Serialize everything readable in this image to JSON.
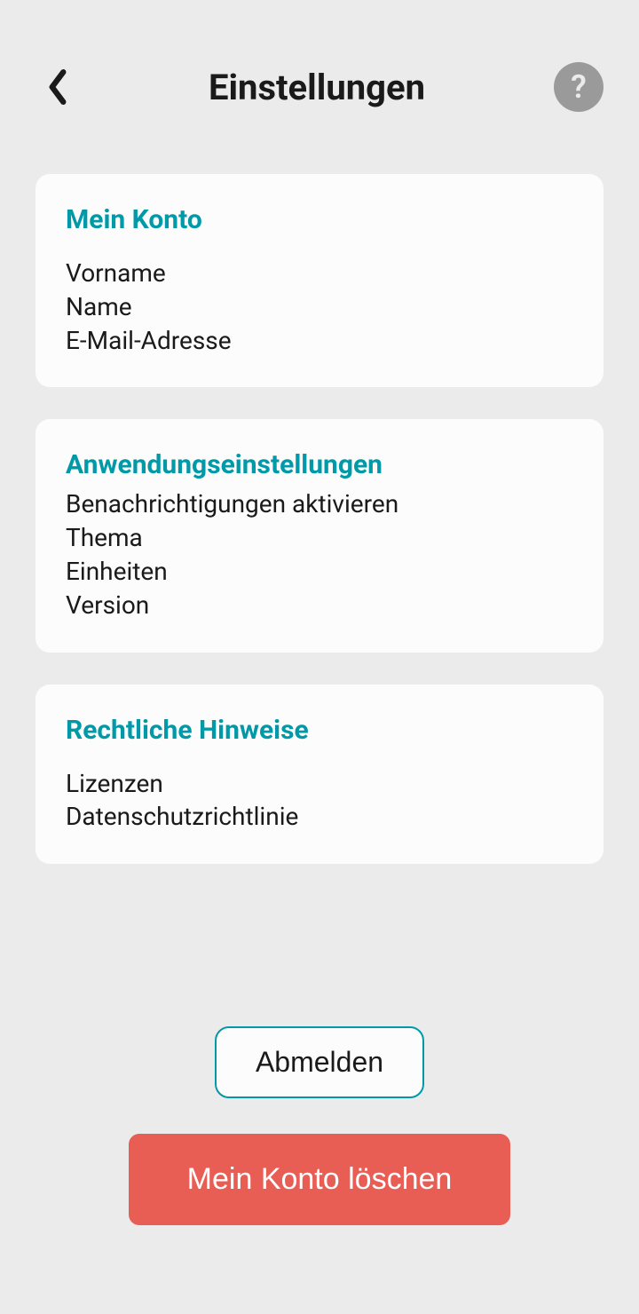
{
  "header": {
    "title": "Einstellungen",
    "help_label": "?"
  },
  "sections": {
    "account": {
      "title": "Mein Konto",
      "items": {
        "firstname": "Vorname",
        "lastname": "Name",
        "email": "E-Mail-Adresse"
      }
    },
    "app_settings": {
      "title": "Anwendungseinstellungen",
      "items": {
        "notifications": "Benachrichtigungen aktivieren",
        "theme": "Thema",
        "units": "Einheiten",
        "version": "Version"
      }
    },
    "legal": {
      "title": "Rechtliche Hinweise",
      "items": {
        "licenses": "Lizenzen",
        "privacy": "Datenschutzrichtlinie"
      }
    }
  },
  "buttons": {
    "logout": "Abmelden",
    "delete_account": "Mein Konto löschen"
  }
}
